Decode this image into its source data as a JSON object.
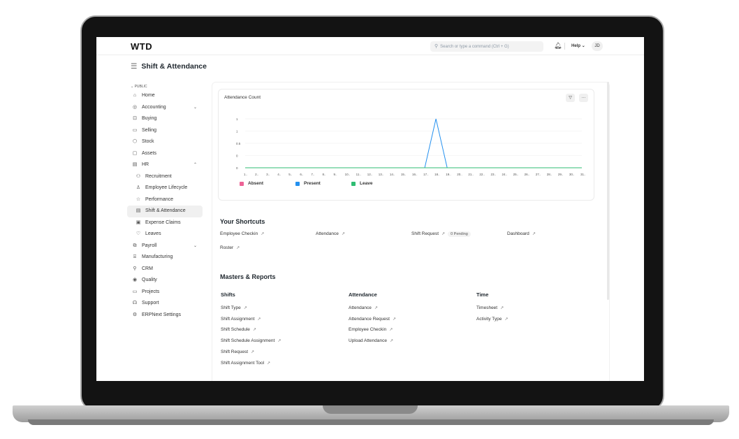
{
  "navbar": {
    "logo": "WTD",
    "search_placeholder": "Search or type a command (Ctrl + G)",
    "help_label": "Help",
    "avatar_initials": "JD"
  },
  "page": {
    "title": "Shift & Attendance"
  },
  "sidebar": {
    "section_label": "PUBLIC",
    "items": [
      {
        "label": "Home",
        "icon": "home-icon",
        "glyph": "⌂"
      },
      {
        "label": "Accounting",
        "icon": "accounting-icon",
        "glyph": "◎",
        "chevron": "⌄"
      },
      {
        "label": "Buying",
        "icon": "buying-icon",
        "glyph": "⊡"
      },
      {
        "label": "Selling",
        "icon": "selling-icon",
        "glyph": "▭"
      },
      {
        "label": "Stock",
        "icon": "stock-icon",
        "glyph": "⬡"
      },
      {
        "label": "Assets",
        "icon": "assets-icon",
        "glyph": "▢"
      },
      {
        "label": "HR",
        "icon": "hr-icon",
        "glyph": "▤",
        "chevron": "⌃"
      },
      {
        "label": "Recruitment",
        "icon": "recruitment-icon",
        "glyph": "⚇",
        "child": true
      },
      {
        "label": "Employee Lifecycle",
        "icon": "employee-lifecycle-icon",
        "glyph": "♙",
        "child": true
      },
      {
        "label": "Performance",
        "icon": "performance-icon",
        "glyph": "☆",
        "child": true
      },
      {
        "label": "Shift & Attendance",
        "icon": "shift-attendance-icon",
        "glyph": "▤",
        "child": true,
        "active": true
      },
      {
        "label": "Expense Claims",
        "icon": "expense-claims-icon",
        "glyph": "▣",
        "child": true
      },
      {
        "label": "Leaves",
        "icon": "leaves-icon",
        "glyph": "♡",
        "child": true
      },
      {
        "label": "Payroll",
        "icon": "payroll-icon",
        "glyph": "⧉",
        "chevron": "⌄"
      },
      {
        "label": "Manufacturing",
        "icon": "manufacturing-icon",
        "glyph": "⌸"
      },
      {
        "label": "CRM",
        "icon": "crm-icon",
        "glyph": "⚲"
      },
      {
        "label": "Quality",
        "icon": "quality-icon",
        "glyph": "◉"
      },
      {
        "label": "Projects",
        "icon": "projects-icon",
        "glyph": "▭"
      },
      {
        "label": "Support",
        "icon": "support-icon",
        "glyph": "☊"
      },
      {
        "label": "ERPNext Settings",
        "icon": "settings-icon",
        "glyph": "⚙"
      }
    ]
  },
  "chart_data": {
    "type": "line",
    "title": "Attendance Count",
    "categories": [
      "1..",
      "2..",
      "3..",
      "4..",
      "5..",
      "6..",
      "7..",
      "8..",
      "9..",
      "10..",
      "11..",
      "12..",
      "13..",
      "14..",
      "15..",
      "16..",
      "17..",
      "18..",
      "19..",
      "20..",
      "21..",
      "22..",
      "23..",
      "24..",
      "25..",
      "26..",
      "27..",
      "28..",
      "29..",
      "30..",
      "31.."
    ],
    "y_ticks": [
      "0",
      "0",
      "0.5",
      "1",
      "1"
    ],
    "ylim": [
      0,
      1
    ],
    "series": [
      {
        "name": "Absent",
        "color": "#ed6396",
        "values": [
          0,
          0,
          0,
          0,
          0,
          0,
          0,
          0,
          0,
          0,
          0,
          0,
          0,
          0,
          0,
          0,
          0,
          0,
          0,
          0,
          0,
          0,
          0,
          0,
          0,
          0,
          0,
          0,
          0,
          0,
          0
        ]
      },
      {
        "name": "Present",
        "color": "#2490ef",
        "values": [
          0,
          0,
          0,
          0,
          0,
          0,
          0,
          0,
          0,
          0,
          0,
          0,
          0,
          0,
          0,
          0,
          0,
          1,
          0,
          0,
          0,
          0,
          0,
          0,
          0,
          0,
          0,
          0,
          0,
          0,
          0
        ]
      },
      {
        "name": "Leave",
        "color": "#2fbd73",
        "values": [
          0,
          0,
          0,
          0,
          0,
          0,
          0,
          0,
          0,
          0,
          0,
          0,
          0,
          0,
          0,
          0,
          0,
          0,
          0,
          0,
          0,
          0,
          0,
          0,
          0,
          0,
          0,
          0,
          0,
          0,
          0
        ]
      }
    ]
  },
  "chart_controls": {
    "filter_glyph": "▽",
    "menu_glyph": "···"
  },
  "shortcuts": {
    "title": "Your Shortcuts",
    "arrow": "↗",
    "items": [
      {
        "label": "Employee Checkin"
      },
      {
        "label": "Attendance"
      },
      {
        "label": "Shift Request",
        "badge": "0 Pending"
      },
      {
        "label": "Dashboard"
      },
      {
        "label": "Roster"
      }
    ]
  },
  "masters": {
    "title": "Masters & Reports",
    "columns": [
      {
        "heading": "Shifts",
        "links": [
          "Shift Type",
          "Shift Assignment",
          "Shift Schedule",
          "Shift Schedule Assignment",
          "Shift Request",
          "Shift Assignment Tool"
        ]
      },
      {
        "heading": "Attendance",
        "links": [
          "Attendance",
          "Attendance Request",
          "Employee Checkin",
          "Upload Attendance"
        ]
      },
      {
        "heading": "Time",
        "links": [
          "Timesheet",
          "Activity Type"
        ]
      }
    ]
  }
}
